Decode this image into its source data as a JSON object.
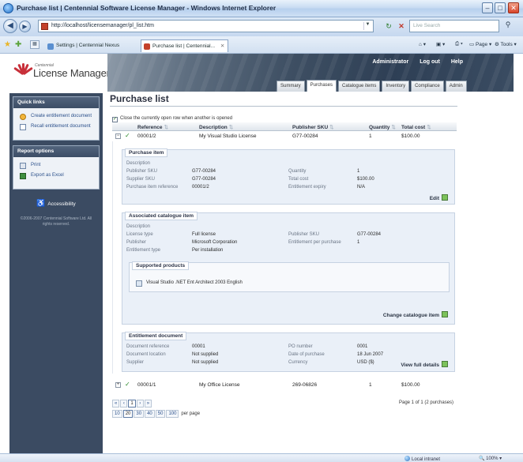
{
  "browser": {
    "window_title": "Purchase list | Centennial Software License Manager - Windows Internet Explorer",
    "url": "http://localhost/licensemanager/pl_list.htm",
    "search_placeholder": "Live Search",
    "tabs": [
      {
        "label": "Settings | Centennial Nexus",
        "active": false
      },
      {
        "label": "Purchase list | Centennial...",
        "active": true
      }
    ],
    "command_bar": {
      "page": "Page",
      "tools": "Tools"
    },
    "status": {
      "zone": "Local intranet",
      "zoom": "100%"
    }
  },
  "app": {
    "logo_small": "Centennial",
    "logo_big": "License Manager",
    "user_links": [
      "Administrator",
      "Log out",
      "Help"
    ],
    "nav_tabs": [
      {
        "label": "Summary",
        "active": false
      },
      {
        "label": "Purchases",
        "active": true
      },
      {
        "label": "Catalogue items",
        "active": false
      },
      {
        "label": "Inventory",
        "active": false
      },
      {
        "label": "Compliance",
        "active": false
      },
      {
        "label": "Admin",
        "active": false
      }
    ],
    "brand_color": "#c8303a"
  },
  "sidebar": {
    "quick_links": {
      "title": "Quick links",
      "items": [
        "Create entitlement document",
        "Recall entitlement document"
      ]
    },
    "report_options": {
      "title": "Report options",
      "items": [
        "Print",
        "Export as Excel"
      ]
    },
    "accessibility": "Accessibility",
    "copyright": "©2006-2007 Centennial Software Ltd. All rights reserved."
  },
  "main": {
    "title": "Purchase list",
    "close_rows_label": "Close the currently open row when another is opened",
    "columns": [
      "Reference",
      "Description",
      "Publisher SKU",
      "Quantity",
      "Total cost"
    ],
    "rows": [
      {
        "reference": "00001/2",
        "description": "My Visual Studio License",
        "sku": "G77-00284",
        "quantity": "1",
        "total": "$100.00",
        "expanded": true
      },
      {
        "reference": "00001/1",
        "description": "My Office License",
        "sku": "269-06826",
        "quantity": "1",
        "total": "$100.00",
        "expanded": false
      }
    ],
    "purchase_item": {
      "title": "Purchase item",
      "fields": [
        {
          "label": "Description",
          "value": ""
        },
        {
          "label": "Publisher SKU",
          "value": "G77-00284"
        },
        {
          "label": "Supplier SKU",
          "value": "G77-00284"
        },
        {
          "label": "Purchase item reference",
          "value": "00001/2"
        }
      ],
      "fields_right": [
        {
          "label": "Quantity",
          "value": "1"
        },
        {
          "label": "Total cost",
          "value": "$100.00"
        },
        {
          "label": "Entitlement expiry",
          "value": "N/A"
        }
      ],
      "action": "Edit"
    },
    "catalogue_item": {
      "title": "Associated catalogue item",
      "fields": [
        {
          "label": "Description",
          "value": ""
        },
        {
          "label": "License type",
          "value": "Full license"
        },
        {
          "label": "Publisher",
          "value": "Microsoft Corporation"
        },
        {
          "label": "Entitlement type",
          "value": "Per installation"
        }
      ],
      "fields_right": [
        {
          "label": "Publisher SKU",
          "value": "G77-00284"
        },
        {
          "label": "Entitlement per purchase",
          "value": "1"
        }
      ],
      "supported_products_title": "Supported products",
      "supported_products": [
        "Visual Studio .NET Ent Architect 2003 English"
      ],
      "action": "Change catalogue item"
    },
    "entitlement_document": {
      "title": "Entitlement document",
      "fields": [
        {
          "label": "Document reference",
          "value": "00001"
        },
        {
          "label": "Document location",
          "value": "Not supplied"
        },
        {
          "label": "Supplier",
          "value": "Not supplied"
        }
      ],
      "fields_right": [
        {
          "label": "PO number",
          "value": "0001"
        },
        {
          "label": "Date of purchase",
          "value": "18 Jun 2007"
        },
        {
          "label": "Currency",
          "value": "USD ($)"
        }
      ],
      "action": "View full details"
    },
    "pager": {
      "buttons": [
        "«",
        "‹",
        "1",
        "›",
        "»"
      ],
      "sizes": [
        "10",
        "20",
        "30",
        "40",
        "50",
        "100"
      ],
      "per_page_label": "per page",
      "info": "Page 1 of 1 (2 purchases)"
    }
  }
}
